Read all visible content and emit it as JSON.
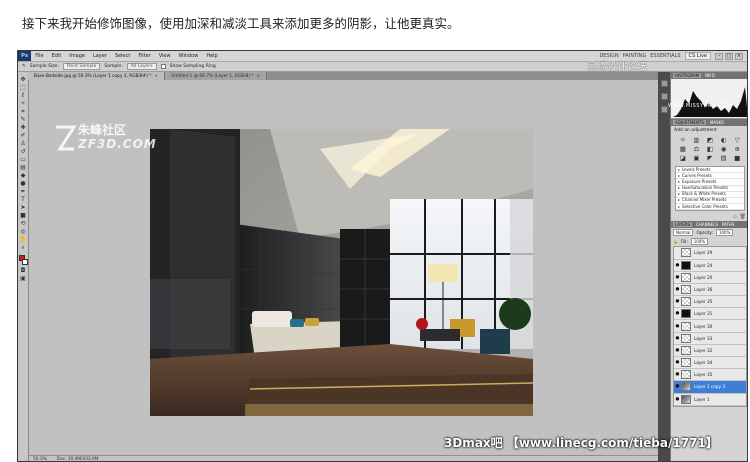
{
  "caption": "接下来我开始修饰图像，使用加深和减淡工具来添加更多的阴影，让他更真实。",
  "menubar": {
    "app_icon": "Ps",
    "items": [
      "File",
      "Edit",
      "Image",
      "Layer",
      "Select",
      "Filter",
      "View",
      "Window",
      "Help"
    ],
    "workspace": [
      "DESIGN",
      "PAINTING",
      "ESSENTIALS"
    ],
    "cs_live": "CS Live"
  },
  "options": {
    "sample_size_label": "Sample Size:",
    "sample_size_value": "Point Sample",
    "sample_label": "Sample:",
    "sample_value": "All Layers",
    "show_ring": "Show Sampling Ring"
  },
  "tabs": [
    {
      "label": "Base Bedside.jpg @ 50.3% (Layer 1 copy 3, RGB/8#) *",
      "active": true
    },
    {
      "label": "Untitled-1 @ 66.7% (Layer 1, RGB/8) *",
      "active": false
    }
  ],
  "tools": [
    "move-icon",
    "marquee-icon",
    "lasso-icon",
    "quick-select-icon",
    "crop-icon",
    "eyedropper-icon",
    "healing-icon",
    "brush-icon",
    "clone-stamp-icon",
    "history-brush-icon",
    "eraser-icon",
    "gradient-icon",
    "blur-icon",
    "dodge-icon",
    "pen-icon",
    "type-icon",
    "path-select-icon",
    "shape-icon",
    "3d-rotate-icon",
    "3d-orbit-icon",
    "hand-icon",
    "zoom-icon"
  ],
  "colors": {
    "foreground": "#e01515",
    "background": "#ffffff",
    "selected_layer": "#3d7fd6"
  },
  "status": {
    "zoom": "50.3%",
    "doc": "Doc: 39.4M/433.9M"
  },
  "histogram": {
    "tab": "HISTOGRAM",
    "tab2": "INFO"
  },
  "adjustments": {
    "tabs": [
      "ADJUSTMENTS",
      "MASKS"
    ],
    "title": "Add an adjustment",
    "icons": [
      "brightness-icon",
      "levels-icon",
      "curves-icon",
      "exposure-icon",
      "vibrance-icon",
      "hue-icon",
      "color-balance-icon",
      "bw-icon",
      "photo-filter-icon",
      "channel-mixer-icon",
      "invert-icon",
      "posterize-icon",
      "threshold-icon",
      "gradient-map-icon",
      "selective-color-icon"
    ],
    "presets": [
      "Levels Presets",
      "Curves Presets",
      "Exposure Presets",
      "Hue/Saturation Presets",
      "Black & White Presets",
      "Channel Mixer Presets",
      "Selective Color Presets"
    ]
  },
  "layers_panel": {
    "tabs": [
      "LAYERS",
      "CHANNELS",
      "PATHS"
    ],
    "blend": "Normal",
    "opacity_label": "Opacity:",
    "opacity": "100%",
    "fill_label": "Fill:",
    "fill": "100%",
    "layers": [
      {
        "name": "Layer 29",
        "visible": false,
        "thumb": "trans"
      },
      {
        "name": "Layer 24",
        "visible": true,
        "thumb": "dark"
      },
      {
        "name": "Layer 20",
        "visible": true,
        "thumb": "trans"
      },
      {
        "name": "Layer 36",
        "visible": true,
        "thumb": "trans"
      },
      {
        "name": "Layer 35",
        "visible": true,
        "thumb": "trans"
      },
      {
        "name": "Layer 31",
        "visible": true,
        "thumb": "dark"
      },
      {
        "name": "Layer 30",
        "visible": true,
        "thumb": "trans"
      },
      {
        "name": "Layer 33",
        "visible": true,
        "thumb": "trans"
      },
      {
        "name": "Layer 32",
        "visible": true,
        "thumb": "trans"
      },
      {
        "name": "Layer 34",
        "visible": true,
        "thumb": "trans"
      },
      {
        "name": "Layer 35",
        "visible": true,
        "thumb": "trans"
      },
      {
        "name": "Layer 1 copy 3",
        "visible": true,
        "thumb": "photo",
        "selected": true
      },
      {
        "name": "Layer 1",
        "visible": true,
        "thumb": "photo"
      }
    ]
  },
  "watermarks": {
    "logo_cn": "朱峰社区",
    "logo_en": "ZF3D.COM",
    "forum": "思缘设计论坛",
    "forum_url": "WWW.MISSYUAN.COM",
    "bottom": "3Dmax吧 【www.linecg.com/tieba/1771】"
  }
}
